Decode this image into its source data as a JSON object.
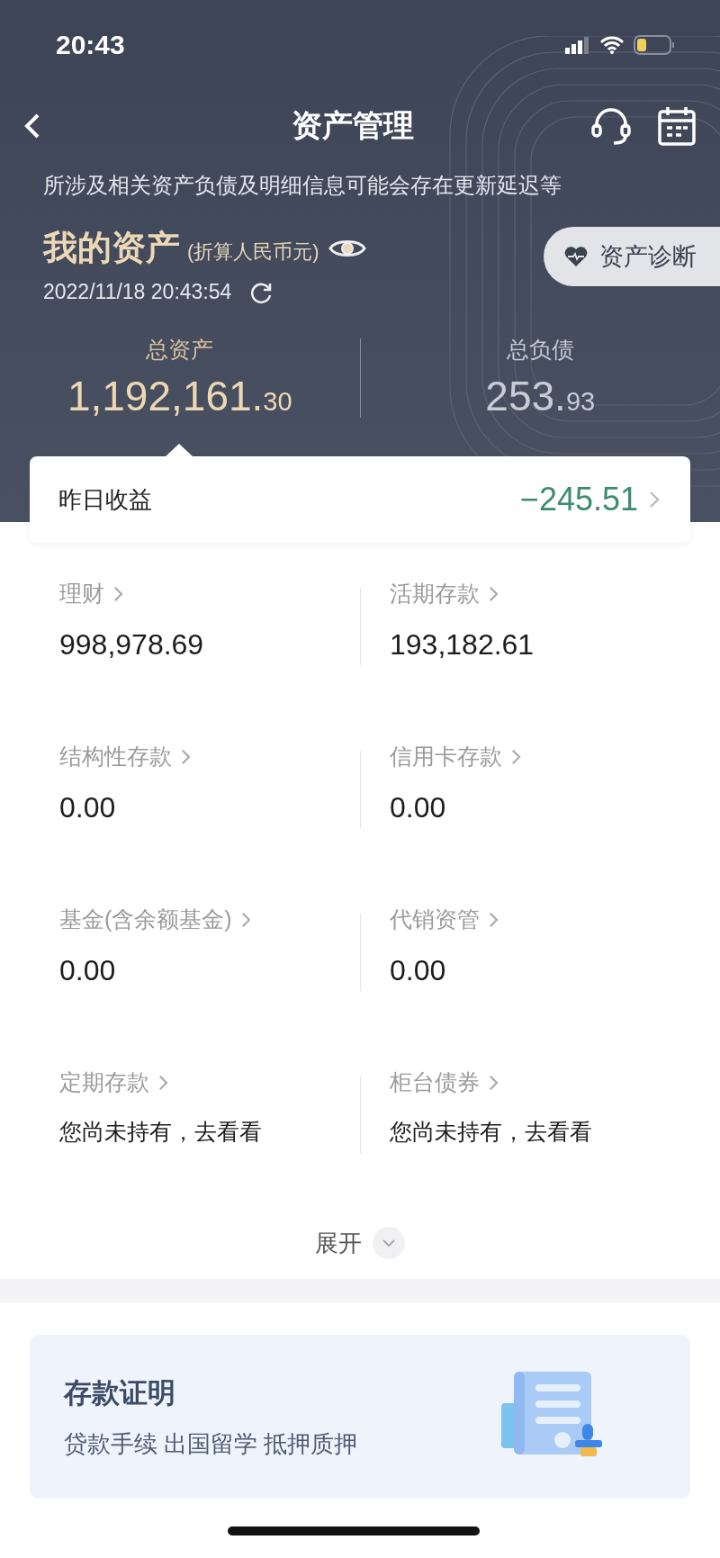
{
  "status_bar": {
    "time": "20:43"
  },
  "nav": {
    "title": "资产管理"
  },
  "notice": "所涉及相关资产负债及明细信息可能会存在更新延迟等",
  "my_assets": {
    "title": "我的资产",
    "unit": "(折算人民币元)",
    "updated": "2022/11/18 20:43:54",
    "diagnosis_button": "资产诊断"
  },
  "totals": [
    {
      "label": "总资产",
      "value_main": "1,192,161.",
      "value_fraction": "30",
      "selected": true
    },
    {
      "label": "总负债",
      "value_main": "253.",
      "value_fraction": "93",
      "selected": false
    }
  ],
  "yesterday": {
    "label": "昨日收益",
    "value": "−245.51"
  },
  "holdings": [
    {
      "label": "理财",
      "kind": "amount",
      "value": "998,978.69"
    },
    {
      "label": "活期存款",
      "kind": "amount",
      "value": "193,182.61"
    },
    {
      "label": "结构性存款",
      "kind": "amount",
      "value": "0.00"
    },
    {
      "label": "信用卡存款",
      "kind": "amount",
      "value": "0.00"
    },
    {
      "label": "基金(含余额基金)",
      "kind": "amount",
      "value": "0.00"
    },
    {
      "label": "代销资管",
      "kind": "amount",
      "value": "0.00"
    },
    {
      "label": "定期存款",
      "kind": "prompt",
      "value": "您尚未持有，去看看"
    },
    {
      "label": "柜台债券",
      "kind": "prompt",
      "value": "您尚未持有，去看看"
    }
  ],
  "expand": {
    "label": "展开"
  },
  "promo": {
    "title": "存款证明",
    "subtitle": "贷款手续 出国留学 抵押质押"
  }
}
